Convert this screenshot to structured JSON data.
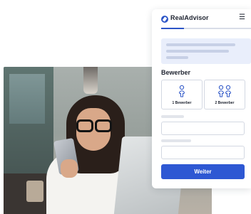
{
  "brand": {
    "name": "RealAdvisor",
    "accent": "#2c55c7"
  },
  "header": {
    "menu_icon": "hamburger-menu-icon"
  },
  "progress": {
    "fraction": 0.25
  },
  "section": {
    "title": "Bewerber"
  },
  "options": [
    {
      "label": "1 Bewerber",
      "icon": "single-person-icon"
    },
    {
      "label": "2 Bewerber",
      "icon": "two-persons-icon"
    }
  ],
  "cta": {
    "label": "Weiter",
    "color": "#2e58d3"
  }
}
